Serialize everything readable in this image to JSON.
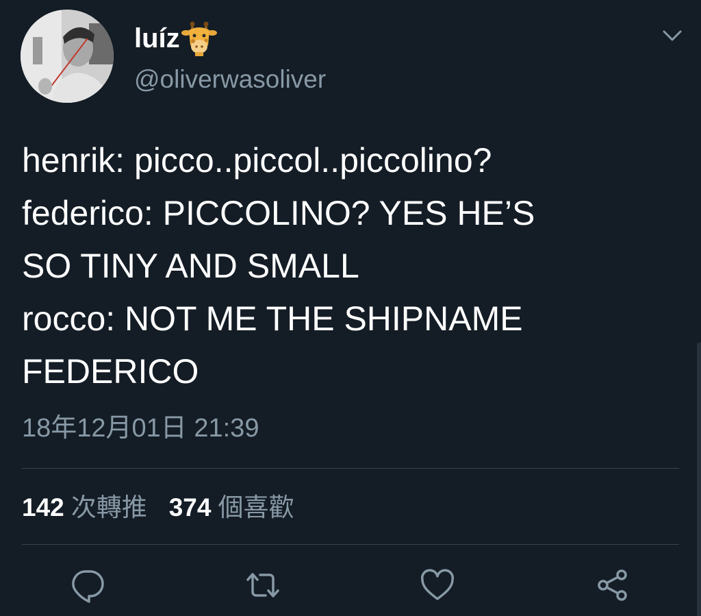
{
  "tweet": {
    "author": {
      "display_name": "luíz",
      "name_emoji": "giraffe-emoji",
      "handle": "@oliverwasoliver"
    },
    "text": "henrik: picco..piccol..piccolino?\nfederico: PICCOLINO? YES HE’S\nSO TINY AND SMALL\nrocco: NOT ME THE SHIPNAME\nFEDERICO",
    "timestamp": "18年12月01日 21:39",
    "stats": {
      "retweets_count": "142",
      "retweets_label": "次轉推",
      "likes_count": "374",
      "likes_label": "個喜歡"
    },
    "actions": [
      {
        "name": "reply",
        "icon": "reply-icon"
      },
      {
        "name": "retweet",
        "icon": "retweet-icon"
      },
      {
        "name": "like",
        "icon": "heart-icon"
      },
      {
        "name": "share",
        "icon": "share-icon"
      }
    ]
  },
  "colors": {
    "background": "#141d26",
    "primary_text": "#ffffff",
    "secondary_text": "#8899a6",
    "divider": "#38444d",
    "icon": "#8899a6"
  }
}
